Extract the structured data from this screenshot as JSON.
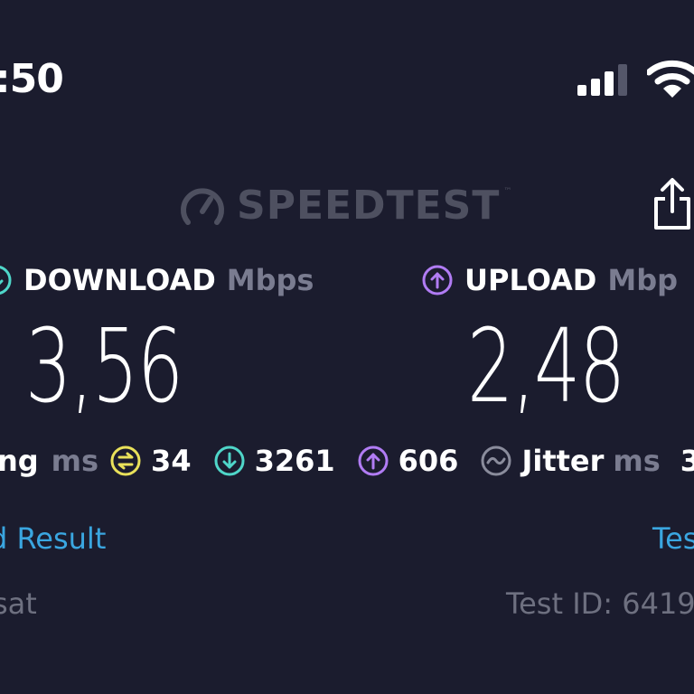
{
  "status_bar": {
    "time": ":50",
    "signal_icon": "cellular-signal-icon",
    "wifi_icon": "wifi-icon"
  },
  "header": {
    "brand": "SPEEDTEST",
    "brand_mark": "™",
    "logo_icon": "speedometer-icon",
    "share_icon": "share-icon"
  },
  "download": {
    "label": "DOWNLOAD",
    "unit": "Mbps",
    "value": "3,56",
    "icon": "download-arrow-icon",
    "color": "#4fd6c9"
  },
  "upload": {
    "label": "UPLOAD",
    "unit": "Mbp",
    "value": "2,48",
    "icon": "upload-arrow-icon",
    "color": "#b17cf4"
  },
  "ping": {
    "label": "ing",
    "unit": "ms",
    "idle_value": "34",
    "idle_icon": "ping-idle-icon",
    "idle_color": "#e9e15a",
    "download_value": "3261",
    "download_icon": "download-arrow-icon",
    "upload_value": "606",
    "upload_icon": "upload-arrow-icon",
    "jitter_label": "Jitter",
    "jitter_unit": "ms",
    "jitter_value": "3",
    "jitter_icon": "jitter-icon"
  },
  "links": {
    "result": "d Result",
    "test": "Tes",
    "color": "#3aa6e0"
  },
  "footer": {
    "provider": "sat",
    "test_id": "Test ID: 6419"
  }
}
